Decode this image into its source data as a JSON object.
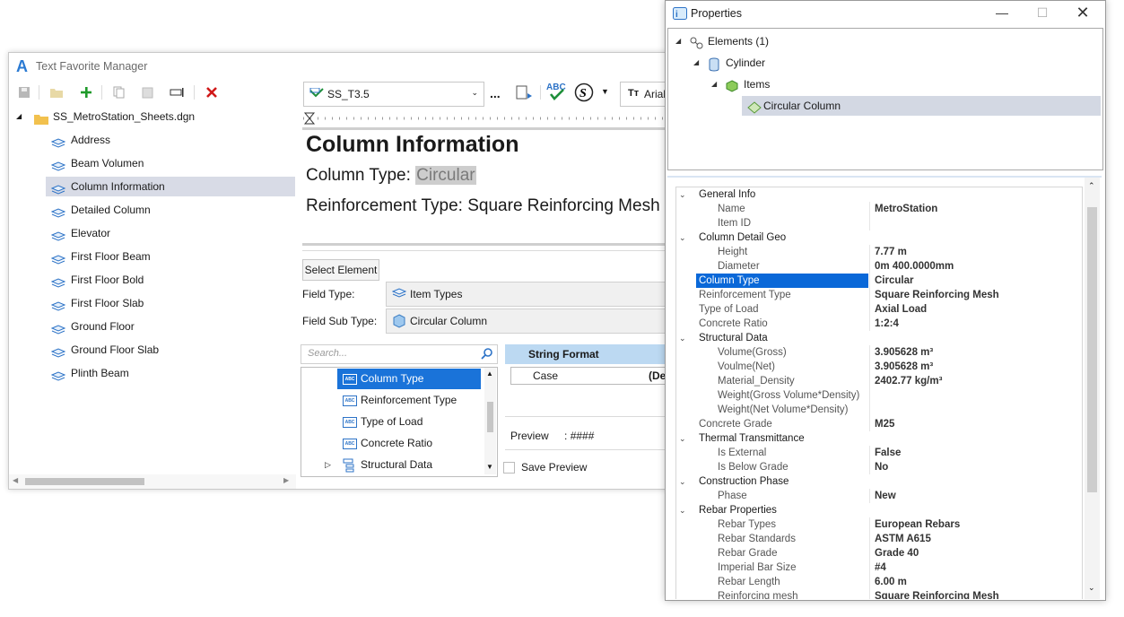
{
  "tfm": {
    "title": "Text Favorite Manager",
    "tree": {
      "root": "SS_MetroStation_Sheets.dgn",
      "items": [
        "Address",
        "Beam Volumen",
        "Column Information",
        "Detailed Column",
        "Elevator",
        "First Floor Beam",
        "First Floor Bold",
        "First Floor Slab",
        "Ground Floor",
        "Ground Floor Slab",
        "Plinth Beam"
      ],
      "selected": "Column Information"
    },
    "style_combo": "SS_T3.5",
    "font_combo": "Arial",
    "ellipsis": "...",
    "editor": {
      "heading": "Column Information",
      "line1_label": "Column Type: ",
      "line1_value": "Circular",
      "line2": "Reinforcement Type: Square Reinforcing Mesh"
    },
    "select_element": "Select Element",
    "field_type_label": "Field Type:",
    "field_type_value": "Item Types",
    "field_subtype_label": "Field Sub Type:",
    "field_subtype_value": "Circular Column",
    "search_placeholder": "Search...",
    "list": [
      "Column Type",
      "Reinforcement Type",
      "Type of Load",
      "Concrete Ratio",
      "Structural Data"
    ],
    "string_format": "String Format",
    "case_label": "Case",
    "case_value": "(De",
    "preview_label": "Preview",
    "preview_value": ": ####",
    "save_preview": "Save Preview",
    "icon_text": "ABC"
  },
  "props": {
    "title": "Properties",
    "tree": {
      "elements": "Elements (1)",
      "cylinder": "Cylinder",
      "items": "Items",
      "circular": "Circular Column"
    },
    "grid": [
      {
        "t": "cat",
        "label": "General Info"
      },
      {
        "t": "p",
        "label": "Name",
        "value": "MetroStation"
      },
      {
        "t": "p",
        "label": "Item ID",
        "value": ""
      },
      {
        "t": "cat",
        "label": "Column Detail Geo"
      },
      {
        "t": "p",
        "label": "Height",
        "value": "7.77 m"
      },
      {
        "t": "p",
        "label": "Diameter",
        "value": "0m 400.0000mm"
      },
      {
        "t": "p1",
        "label": "Column Type",
        "value": "Circular",
        "sel": true
      },
      {
        "t": "p1",
        "label": "Reinforcement Type",
        "value": "Square Reinforcing Mesh"
      },
      {
        "t": "p1",
        "label": "Type of Load",
        "value": "Axial Load"
      },
      {
        "t": "p1",
        "label": "Concrete Ratio",
        "value": "1:2:4"
      },
      {
        "t": "cat",
        "label": "Structural Data"
      },
      {
        "t": "p",
        "label": "Volume(Gross)",
        "value": "3.905628 m³"
      },
      {
        "t": "p",
        "label": "Voulme(Net)",
        "value": "3.905628 m³"
      },
      {
        "t": "p",
        "label": "Material_Density",
        "value": "2402.77 kg/m³"
      },
      {
        "t": "p",
        "label": "Weight(Gross Volume*Density)",
        "value": ""
      },
      {
        "t": "p",
        "label": "Weight(Net Volume*Density)",
        "value": ""
      },
      {
        "t": "p1",
        "label": "Concrete Grade",
        "value": "M25"
      },
      {
        "t": "cat",
        "label": "Thermal Transmittance"
      },
      {
        "t": "p",
        "label": "Is External",
        "value": "False"
      },
      {
        "t": "p",
        "label": "Is Below Grade",
        "value": "No"
      },
      {
        "t": "cat",
        "label": "Construction Phase"
      },
      {
        "t": "p",
        "label": "Phase",
        "value": "New"
      },
      {
        "t": "cat",
        "label": "Rebar Properties"
      },
      {
        "t": "p",
        "label": "Rebar Types",
        "value": "European Rebars"
      },
      {
        "t": "p",
        "label": "Rebar Standards",
        "value": "ASTM A615"
      },
      {
        "t": "p",
        "label": "Rebar Grade",
        "value": "Grade 40"
      },
      {
        "t": "p",
        "label": "Imperial Bar Size",
        "value": "#4"
      },
      {
        "t": "p",
        "label": "Rebar Length",
        "value": "6.00 m"
      },
      {
        "t": "p",
        "label": "Reinforcing mesh",
        "value": "Square Reinforcing Mesh"
      }
    ]
  },
  "colors": {
    "accent": "#0a68d8",
    "tree_sel": "#d8dbe6",
    "string_format": "#bcd9f2"
  }
}
